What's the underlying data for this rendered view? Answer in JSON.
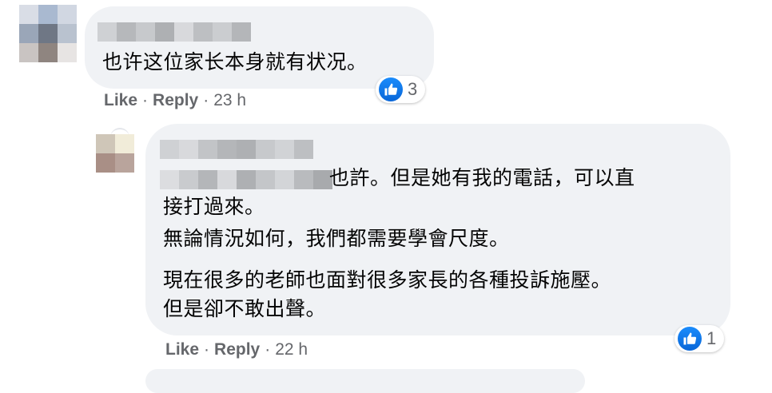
{
  "comments": [
    {
      "text_lines": [
        "也许这位家长本身就有状况。"
      ],
      "reaction_count": "3",
      "actions": {
        "like": "Like",
        "reply": "Reply",
        "time": "23 h"
      }
    },
    {
      "text_lines": [
        "也許。但是她有我的電話，可以直",
        "接打過來。",
        "無論情況如何，我們都需要學會尺度。",
        "現在很多的老師也面對很多家長的各種投訴施壓。",
        "但是卻不敢出聲。"
      ],
      "reaction_count": "1",
      "actions": {
        "like": "Like",
        "reply": "Reply",
        "time": "22 h"
      }
    }
  ],
  "separator": "·",
  "icons": {
    "reaction": "thumbs-up-icon"
  },
  "colors": {
    "bubble": "#f0f2f5",
    "secondary_text": "#65676b",
    "like_blue": "#0866d8"
  }
}
